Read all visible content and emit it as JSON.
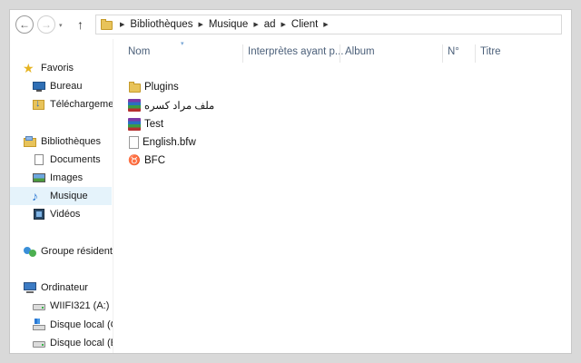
{
  "toolbar": {
    "back_glyph": "←",
    "forward_glyph": "→",
    "history_glyph": "▾",
    "up_glyph": "↑",
    "breadcrumb": [
      "Bibliothèques",
      "Musique",
      "ad",
      "Client"
    ],
    "breadcrumb_separator": "▶"
  },
  "sidebar": {
    "favorites": {
      "label": "Favoris",
      "icon": "star-icon"
    },
    "favorite_items": [
      {
        "label": "Bureau",
        "icon": "desktop-icon"
      },
      {
        "label": "Téléchargements",
        "icon": "downloads-icon"
      }
    ],
    "libraries": {
      "label": "Bibliothèques",
      "icon": "library-icon"
    },
    "library_items": [
      {
        "label": "Documents",
        "icon": "documents-icon"
      },
      {
        "label": "Images",
        "icon": "pictures-icon"
      },
      {
        "label": "Musique",
        "icon": "music-icon",
        "selected": true
      },
      {
        "label": "Vidéos",
        "icon": "videos-icon"
      }
    ],
    "homegroup": {
      "label": "Groupe résidentiel",
      "icon": "homegroup-icon"
    },
    "computer": {
      "label": "Ordinateur",
      "icon": "computer-icon"
    },
    "drives": [
      {
        "label": "WIIFI321 (A:)",
        "icon": "removable-drive-icon"
      },
      {
        "label": "Disque local (C:)",
        "icon": "system-drive-icon"
      },
      {
        "label": "Disque local (E:)",
        "icon": "local-drive-icon"
      }
    ]
  },
  "columns": [
    "Nom",
    "Interprètes ayant p...",
    "Album",
    "N°",
    "Titre"
  ],
  "sort_indicator": "▾",
  "files": [
    {
      "name": "Plugins",
      "icon": "folder-icon"
    },
    {
      "name": "ملف مراد كسره",
      "icon": "rar-archive-icon"
    },
    {
      "name": "Test",
      "icon": "rar-archive-icon"
    },
    {
      "name": "English.bfw",
      "icon": "document-icon"
    },
    {
      "name": "BFC",
      "icon": "bfc-app-icon"
    }
  ],
  "colors": {
    "selection": "#e5f3fb",
    "column_header_text": "#4c607a",
    "background": "#d9d9d9"
  }
}
